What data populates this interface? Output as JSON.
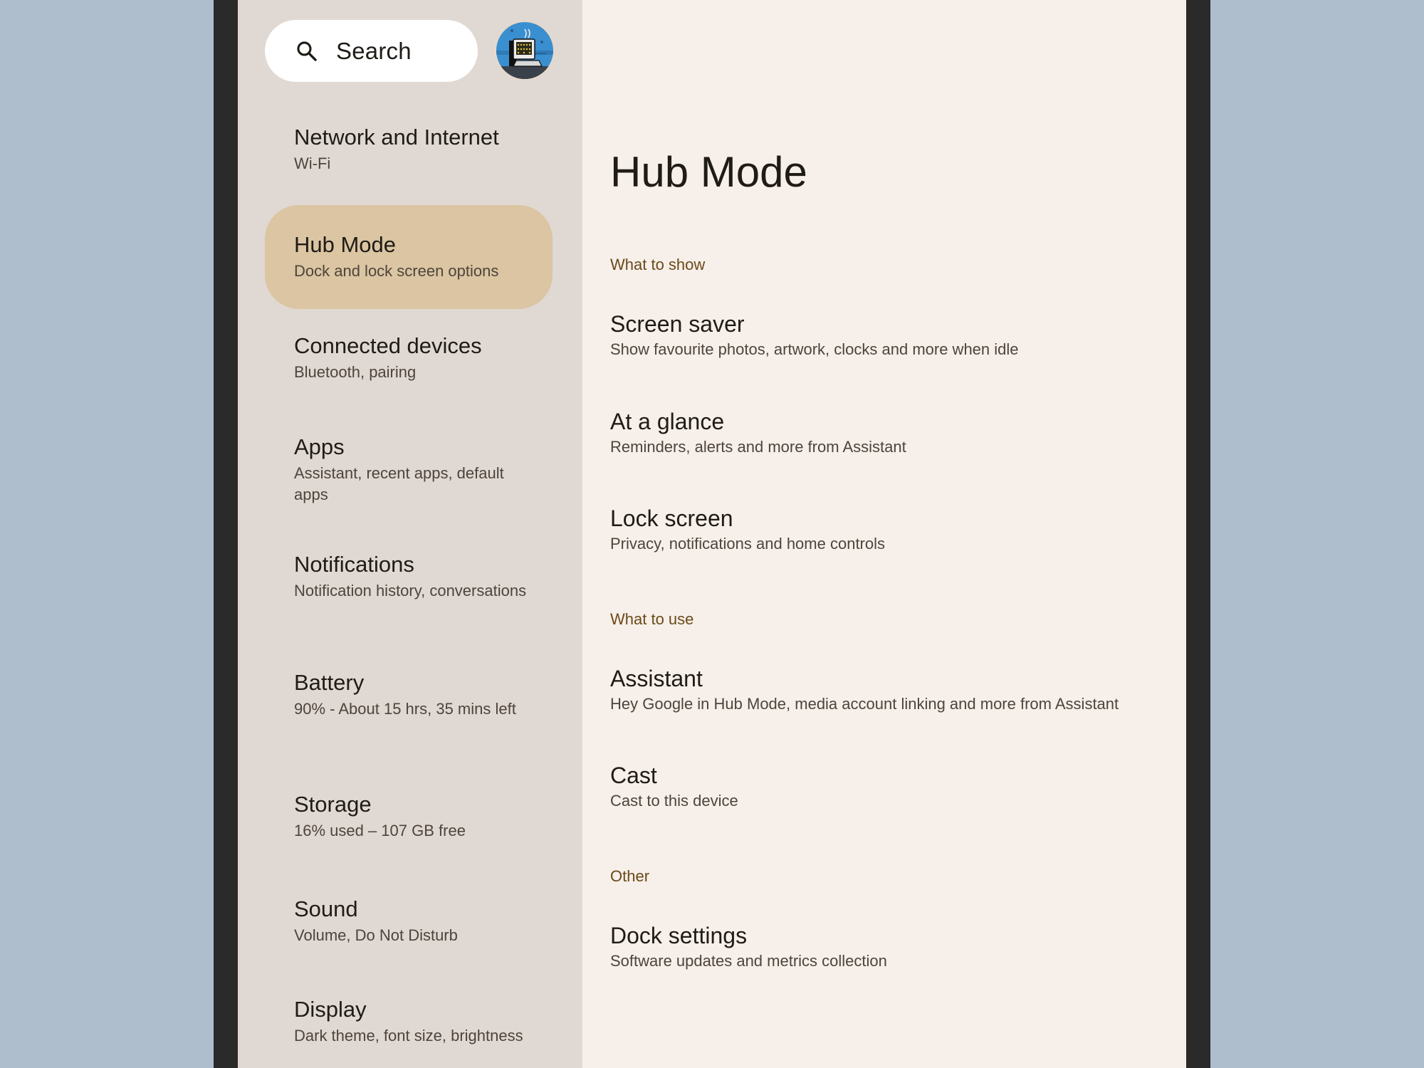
{
  "sidebar": {
    "search": {
      "label": "Search",
      "icon": "search-icon"
    },
    "avatar": {
      "icon": "account-avatar-icon"
    },
    "items": [
      {
        "title": "Network and Internet",
        "subtitle": "Wi-Fi",
        "active": false
      },
      {
        "title": "Hub Mode",
        "subtitle": "Dock and lock screen options",
        "active": true
      },
      {
        "title": "Connected devices",
        "subtitle": "Bluetooth, pairing",
        "active": false
      },
      {
        "title": "Apps",
        "subtitle": "Assistant, recent apps, default apps",
        "active": false
      },
      {
        "title": "Notifications",
        "subtitle": "Notification history, conversations",
        "active": false
      },
      {
        "title": "Battery",
        "subtitle": "90% - About 15 hrs, 35 mins left",
        "active": false
      },
      {
        "title": "Storage",
        "subtitle": "16% used – 107 GB free",
        "active": false
      },
      {
        "title": "Sound",
        "subtitle": "Volume, Do Not Disturb",
        "active": false
      },
      {
        "title": "Display",
        "subtitle": "Dark theme, font size, brightness",
        "active": false
      }
    ]
  },
  "main": {
    "title": "Hub Mode",
    "sections": [
      {
        "header": "What to show",
        "items": [
          {
            "title": "Screen saver",
            "subtitle": "Show favourite photos, artwork, clocks and more when idle"
          },
          {
            "title": "At a glance",
            "subtitle": "Reminders, alerts and more from Assistant"
          },
          {
            "title": "Lock screen",
            "subtitle": "Privacy, notifications and home controls"
          }
        ]
      },
      {
        "header": "What to use",
        "items": [
          {
            "title": "Assistant",
            "subtitle": "Hey Google in Hub Mode, media account linking and more from Assistant"
          },
          {
            "title": "Cast",
            "subtitle": "Cast to this device"
          }
        ]
      },
      {
        "header": "Other",
        "items": [
          {
            "title": "Dock settings",
            "subtitle": "Software updates and metrics collection"
          }
        ]
      }
    ]
  },
  "colors": {
    "background": "#aebecc",
    "bezel": "#2a2a2a",
    "sidebar": "#e0d8d2",
    "content": "#f7efe9",
    "active_item": "#dbc5a2",
    "section_header": "#6a4a1a"
  }
}
